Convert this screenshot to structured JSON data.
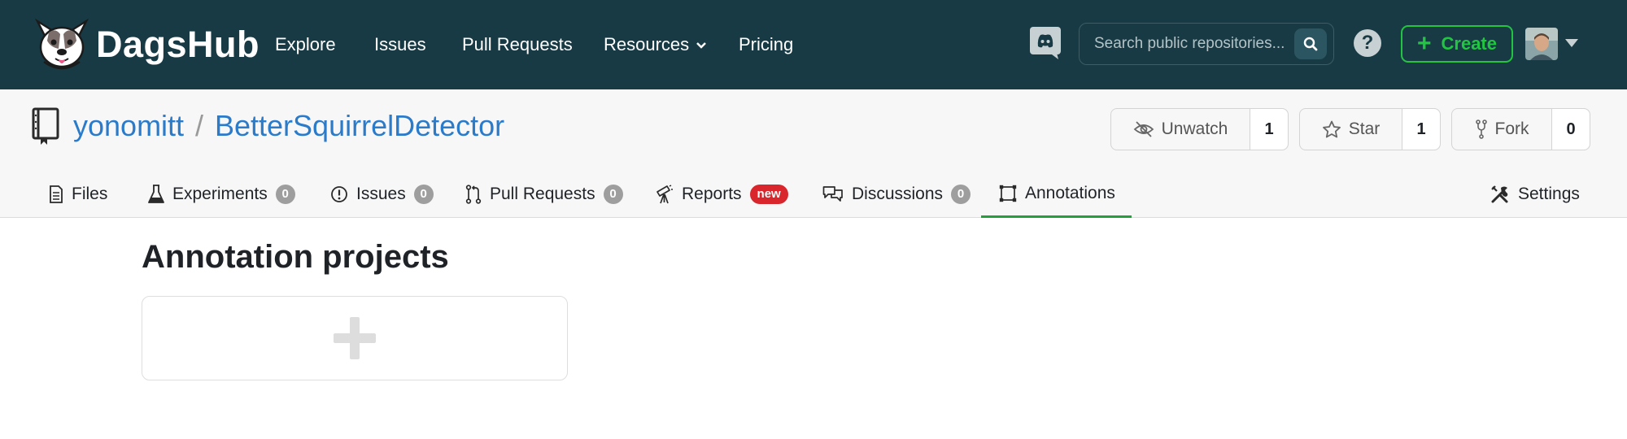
{
  "brand": {
    "name": "DagsHub",
    "accent": "#22c542",
    "nav_bg": "#173a44",
    "link": "#2b7bcb"
  },
  "nav": {
    "links": [
      "Explore",
      "Issues",
      "Pull Requests",
      "Resources",
      "Pricing"
    ],
    "search_placeholder": "Search public repositories...",
    "help_label": "?",
    "create_label": "Create"
  },
  "repo": {
    "owner": "yonomitt",
    "separator": "/",
    "name": "BetterSquirrelDetector",
    "actions": {
      "watch": {
        "label": "Unwatch",
        "count": "1"
      },
      "star": {
        "label": "Star",
        "count": "1"
      },
      "fork": {
        "label": "Fork",
        "count": "0"
      }
    },
    "tabs": [
      {
        "label": "Files"
      },
      {
        "label": "Experiments",
        "count": "0"
      },
      {
        "label": "Issues",
        "count": "0"
      },
      {
        "label": "Pull Requests",
        "count": "0"
      },
      {
        "label": "Reports",
        "badge": "new"
      },
      {
        "label": "Discussions",
        "count": "0"
      },
      {
        "label": "Annotations",
        "active": true
      },
      {
        "label": "Settings"
      }
    ]
  },
  "main": {
    "title": "Annotation projects"
  },
  "icons": [
    "dagshub-logo-icon",
    "discord-icon",
    "search-icon",
    "help-icon",
    "plus-icon",
    "repo-book-icon",
    "eye-slash-icon",
    "star-icon",
    "fork-icon",
    "file-icon",
    "flask-icon",
    "issue-icon",
    "pull-request-icon",
    "telescope-icon",
    "discussion-icon",
    "bounding-box-icon",
    "tools-icon"
  ]
}
